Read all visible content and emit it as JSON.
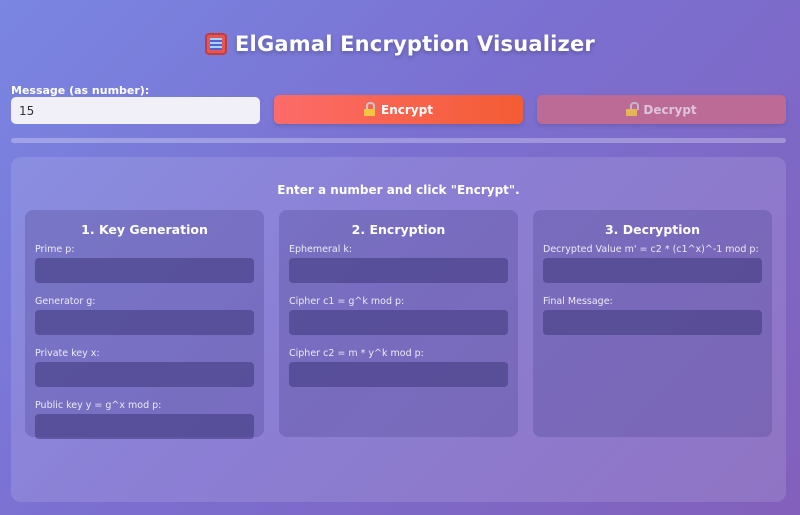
{
  "app": {
    "title": "ElGamal Encryption Visualizer",
    "title_icon": "abacus-icon"
  },
  "controls": {
    "message_label": "Message (as number):",
    "message_value": "15",
    "encrypt_label": "Encrypt",
    "decrypt_label": "Decrypt",
    "encrypt_icon": "lock-icon",
    "decrypt_icon": "unlock-icon"
  },
  "status": {
    "text": "Enter a number and click \"Encrypt\"."
  },
  "sections": [
    {
      "title": "1. Key Generation",
      "fields": [
        {
          "label": "Prime p:",
          "value": ""
        },
        {
          "label": "Generator g:",
          "value": ""
        },
        {
          "label": "Private key x:",
          "value": ""
        },
        {
          "label": "Public key y = g^x mod p:",
          "value": ""
        }
      ]
    },
    {
      "title": "2. Encryption",
      "fields": [
        {
          "label": "Ephemeral k:",
          "value": ""
        },
        {
          "label": "Cipher c1 = g^k mod p:",
          "value": ""
        },
        {
          "label": "Cipher c2 = m * y^k mod p:",
          "value": ""
        }
      ]
    },
    {
      "title": "3. Decryption",
      "fields": [
        {
          "label": "Decrypted Value m' = c2 * (c1^x)^-1 mod p:",
          "value": ""
        },
        {
          "label": "Final Message:",
          "value": ""
        }
      ]
    }
  ],
  "colors": {
    "background_start": "#7a86e2",
    "background_end": "#8260bb",
    "encrypt_start": "#fc6b6a",
    "encrypt_end": "#f45c33",
    "decrypt": "#c86b8e"
  }
}
